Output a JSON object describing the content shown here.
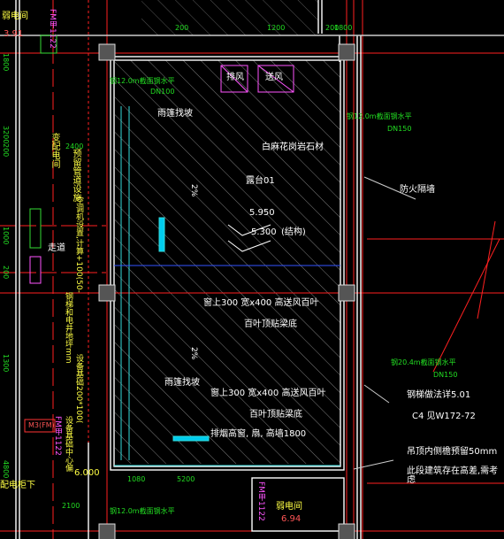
{
  "colors": {
    "background": "#000000",
    "wall": "#ffffff",
    "hatch": "#8a8a8a",
    "axis_red": "#ff2020",
    "dim_green": "#22dd22",
    "text_white": "#ffffff",
    "text_yellow": "#ffff44",
    "text_magenta": "#ff55ff",
    "text_cyan": "#33dddd",
    "blue": "#3355ff"
  },
  "labels": {
    "room_top_right": "弱电间",
    "room_top_right_value": "3.91",
    "fm_top": "FM甲1122",
    "dim_200_a": "200",
    "dim_200_b": "200",
    "dim_1200": "1200",
    "dim_2400": "2400",
    "dim_1800": "1800",
    "equip_paifeng": "排风",
    "equip_songfeng": "送风",
    "pipe_top": "钢12.0m截面钢水平",
    "dn_top": "DN100",
    "pipe_right": "钢12.0m截面钢水平",
    "dn_right": "DN150",
    "note_stone": "白麻花岗岩石材",
    "note_firewall": "防火隔墙",
    "platform": "露台01",
    "elev_1": "5.950",
    "elev_2": "5.300",
    "elev_2_note": "(结构)",
    "slope_1": "2%",
    "slope_2": "2%",
    "rain_1": "雨篷找坡",
    "rain_2": "雨篷找坡",
    "win_note_1": "窗上300  宽x400  高送风百叶",
    "win_note_1b": "百叶顶贴梁底",
    "win_note_2": "窗上300  宽x400  高送风百叶",
    "win_note_2b": "百叶顶贴梁底",
    "exhaust_note": "排烟高窗, 扇, 高墙1800",
    "pipe_right_2": "钢20.4m截面钢水平",
    "dn_right_2": "DN150",
    "steel_note": "钢梯做法详5.01",
    "ref_note": "C4   见W172-72",
    "ceiling_note": "吊顶内侧檐预留50mm",
    "rain_note": "此段建筑存在高差,需考虑",
    "left_vert_1": "预留管道设施",
    "left_vert_2": "变配电间",
    "left_vert_3": "空调机设置,计算+100(50-",
    "left_vert_4": "钢梯和电井地坪mm",
    "left_vert_5": "设备基础200*100(",
    "left_vert_6": "设备基础中心偏",
    "left_corridor": "走道",
    "fm_left": "FM甲1122",
    "fm_left_2": "FM甲1122",
    "pipe_bottom": "钢12.0m截面钢水平",
    "room_bottom": "弱电间",
    "room_bottom_value": "6.94",
    "fm_bottom": "FM甲1122",
    "elev_left": "6.000",
    "dim_5200": "5200",
    "dim_1080": "1080",
    "dim_2100": "2100",
    "left_bottom_box": "M3(FM)",
    "left_bottom_text": "配电柜下",
    "left_dims": [
      "1800",
      "3200",
      "200",
      "1000",
      "200",
      "1300",
      "4800"
    ]
  }
}
